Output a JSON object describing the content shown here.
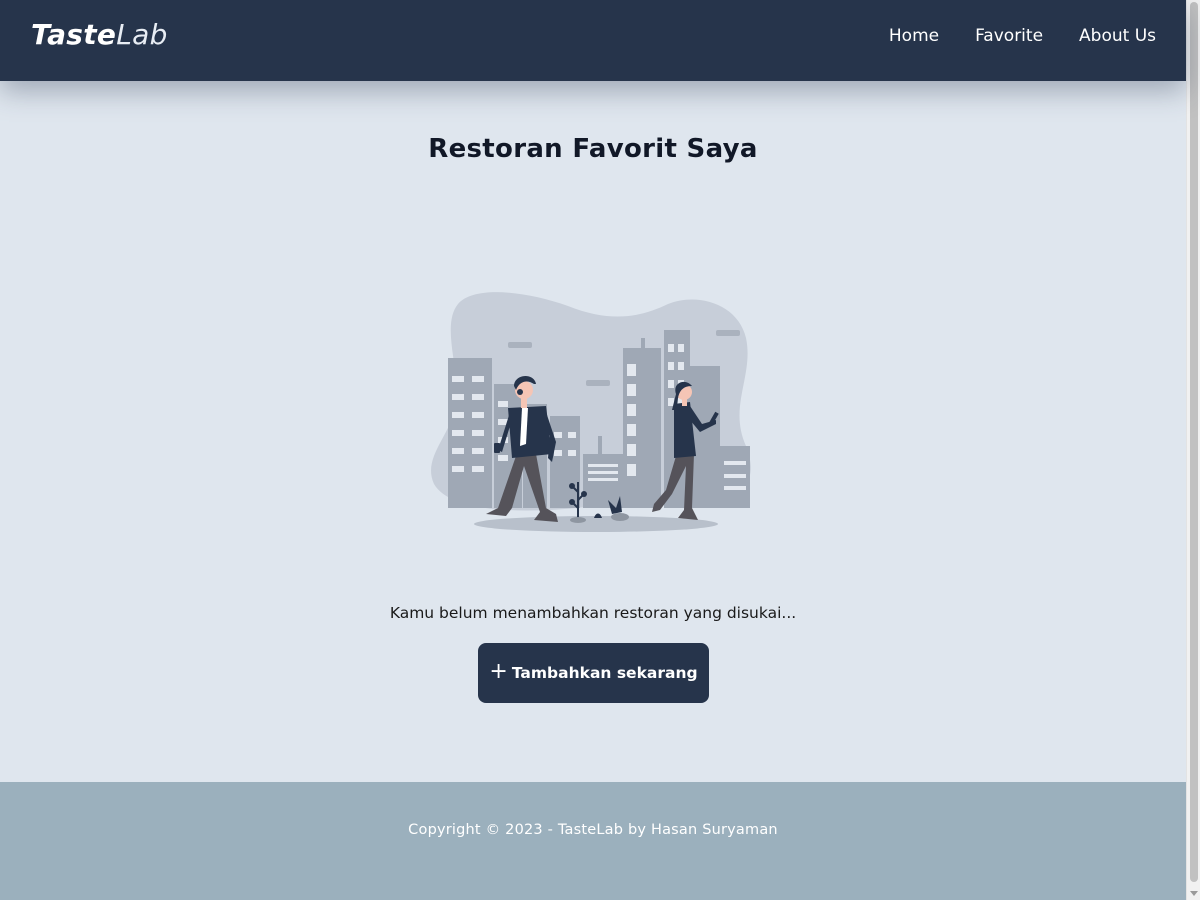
{
  "brand": {
    "bold": "Taste",
    "light": "Lab"
  },
  "nav": {
    "items": [
      {
        "label": "Home"
      },
      {
        "label": "Favorite"
      },
      {
        "label": "About Us"
      }
    ]
  },
  "main": {
    "title": "Restoran Favorit Saya",
    "illustration_icon": "city-walking-illustration",
    "empty_message": "Kamu belum menambahkan restoran yang disukai...",
    "add_button": {
      "icon": "+",
      "label": "Tambahkan sekarang"
    }
  },
  "footer": {
    "copyright": "Copyright © 2023 - TasteLab by Hasan Suryaman"
  },
  "colors": {
    "navbar": "#26344b",
    "background": "#dfe6ee",
    "footer": "#9bb0bd",
    "button": "#26344b"
  }
}
